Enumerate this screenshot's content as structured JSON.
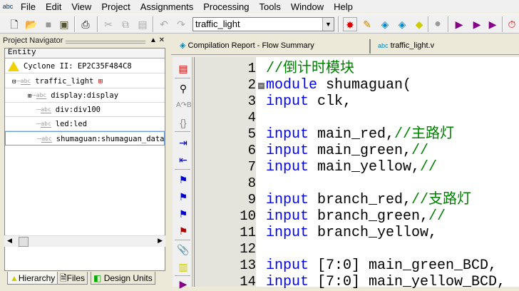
{
  "menu": [
    "File",
    "Edit",
    "View",
    "Project",
    "Assignments",
    "Processing",
    "Tools",
    "Window",
    "Help"
  ],
  "toolbar": {
    "entity_combo": "traffic_light"
  },
  "navigator": {
    "title": "Project Navigator",
    "column": "Entity",
    "device": "Cyclone II: EP2C35F484C8",
    "items": [
      "traffic_light",
      "display:display",
      "div:div100",
      "led:led",
      "shumaguan:shumaguan_data"
    ],
    "tabs": [
      "Hierarchy",
      "Files",
      "Design Units"
    ]
  },
  "doc_tabs": [
    "Compilation Report - Flow Summary",
    "traffic_light.v"
  ],
  "editor": {
    "lines": [
      {
        "n": "1",
        "parts": [
          [
            "cm",
            "//倒计时模块"
          ]
        ]
      },
      {
        "n": "2",
        "parts": [
          [
            "kw",
            "module"
          ],
          [
            "id",
            " shumaguan("
          ]
        ]
      },
      {
        "n": "3",
        "parts": [
          [
            "kw",
            "input"
          ],
          [
            "id",
            " clk,"
          ]
        ]
      },
      {
        "n": "4",
        "parts": []
      },
      {
        "n": "5",
        "parts": [
          [
            "kw",
            "input"
          ],
          [
            "id",
            " main_red,"
          ],
          [
            "cm",
            "//主路灯"
          ]
        ]
      },
      {
        "n": "6",
        "parts": [
          [
            "kw",
            "input"
          ],
          [
            "id",
            " main_green,"
          ],
          [
            "cm",
            "//"
          ]
        ]
      },
      {
        "n": "7",
        "parts": [
          [
            "kw",
            "input"
          ],
          [
            "id",
            " main_yellow,"
          ],
          [
            "cm",
            "//"
          ]
        ]
      },
      {
        "n": "8",
        "parts": []
      },
      {
        "n": "9",
        "parts": [
          [
            "kw",
            "input"
          ],
          [
            "id",
            " branch_red,"
          ],
          [
            "cm",
            "//支路灯"
          ]
        ]
      },
      {
        "n": "10",
        "parts": [
          [
            "kw",
            "input"
          ],
          [
            "id",
            " branch_green,"
          ],
          [
            "cm",
            "//"
          ]
        ]
      },
      {
        "n": "11",
        "parts": [
          [
            "kw",
            "input"
          ],
          [
            "id",
            " branch_yellow,"
          ]
        ]
      },
      {
        "n": "12",
        "parts": []
      },
      {
        "n": "13",
        "parts": [
          [
            "kw",
            "input"
          ],
          [
            "id",
            " [7:0] main_green_BCD,"
          ]
        ]
      },
      {
        "n": "14",
        "parts": [
          [
            "kw",
            "input"
          ],
          [
            "id",
            " [7:0] main_yellow_BCD,"
          ]
        ]
      }
    ]
  }
}
